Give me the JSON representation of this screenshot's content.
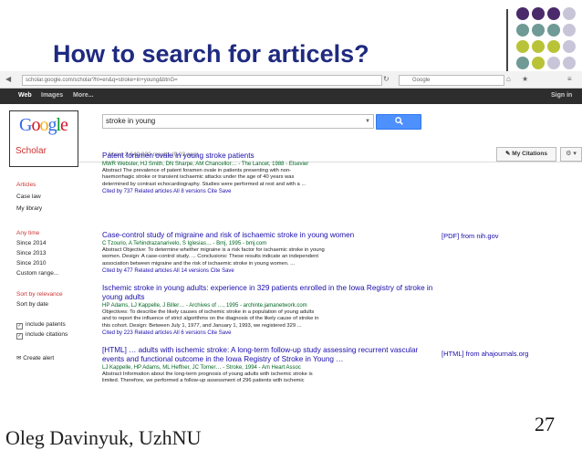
{
  "slide": {
    "title": "How to search for articels?",
    "page_number": "27",
    "footer": "Oleg Davinyuk, UzhNU",
    "dot_colors": [
      "#4b2a6b",
      "#6f9a95",
      "#b9c337",
      "#c9c5d8"
    ]
  },
  "browser": {
    "url": "scholar.google.com/scholar?hl=en&q=stroke+in+young&btnG=",
    "search_placeholder": "Google"
  },
  "google_bar": {
    "items": [
      "Web",
      "Images",
      "More..."
    ],
    "sign_in": "Sign in"
  },
  "scholar": {
    "logo_letters": [
      "G",
      "o",
      "o",
      "g",
      "l",
      "e"
    ],
    "logo_colors": [
      "#3369e8",
      "#d50f25",
      "#eeb211",
      "#3369e8",
      "#009925",
      "#d50f25"
    ],
    "label": "Scholar",
    "query": "stroke in young",
    "search_icon": "search-icon",
    "results_count": "About 2,640,000 results (0.03 sec)",
    "my_citations": "My Citations",
    "settings_icon": "gear-icon"
  },
  "sidebar": {
    "types": [
      "Articles",
      "Case law",
      "My library"
    ],
    "times": [
      "Any time",
      "Since 2014",
      "Since 2013",
      "Since 2010",
      "Custom range..."
    ],
    "sorts": [
      "Sort by relevance",
      "Sort by date"
    ],
    "checks": [
      "include patents",
      "include citations"
    ],
    "create_alert": "Create alert"
  },
  "results": [
    {
      "title": "Patent foramen ovale in young stroke patients",
      "authors": "MWR Webster, HJ Smith, DN Sharpe, AM Chancellor… - The Lancet, 1988 - Elsevier",
      "snippet": [
        "Abstract The prevalence of patent foramen ovale in patients presenting with non-",
        "haemorrhagic stroke or transient ischaemic attacks under the age of 40 years was",
        "determined by contrast echocardiography. Studies were performed at rest and with a ..."
      ],
      "links": "Cited by 737   Related articles   All 8 versions   Cite   Save",
      "side": ""
    },
    {
      "title": "Case-control study of migraine and risk of ischaemic stroke in young women",
      "authors": "C Tzourio, A Tehindrazanarivelo, S Iglesias… - Bmj, 1995 - bmj.com",
      "snippet": [
        "Abstract Objective: To determine whether migraine is a risk factor for ischaemic stroke in young",
        "women. Design: A case-control study. ... Conclusions: These results indicate an independent",
        "association between migraine and the risk of ischaemic stroke in young women. ..."
      ],
      "links": "Cited by 477   Related articles   All 14 versions   Cite   Save",
      "side": "[PDF] from nih.gov"
    },
    {
      "title": "Ischemic stroke in young adults: experience in 329 patients enrolled in the Iowa Registry of stroke in young adults",
      "authors": "HP Adams, LJ Kappelle, J Biller… - Archives of …, 1995 - archinte.jamanetwork.com",
      "snippet": [
        "Objectives: To describe the likely causes of ischemic stroke in a population of young adults",
        "and to report the influence of strict algorithms on the diagnosis of the likely cause of stroke in",
        "this cohort. Design: Between July 1, 1977, and January 1, 1993, we registered 329 ..."
      ],
      "links": "Cited by 223   Related articles   All 6 versions   Cite   Save",
      "side": ""
    },
    {
      "title": "[HTML] … adults with ischemic stroke: A long-term follow-up study assessing recurrent vascular events and functional outcome in the Iowa Registry of Stroke in Young …",
      "authors": "LJ Kappelle, HP Adams, ML Heffner, JC Torner… - Stroke, 1994 - Am Heart Assoc",
      "snippet": [
        "Abstract Information about the long-term prognosis of young adults with ischemic stroke is",
        "limited. Therefore, we performed a follow-up assessment of 296 patients with ischemic"
      ],
      "links": "",
      "side": "[HTML] from ahajournals.org"
    }
  ]
}
